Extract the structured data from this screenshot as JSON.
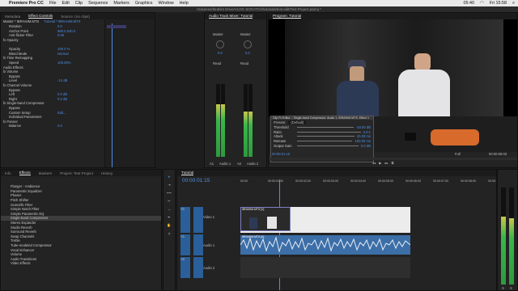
{
  "menubar": {
    "apple": "",
    "app": "Premiere Pro CC",
    "items": [
      "File",
      "Edit",
      "Clip",
      "Sequence",
      "Markers",
      "Graphics",
      "Window",
      "Help"
    ],
    "time": "05:40",
    "clock": "Fri 15:58"
  },
  "title": "/Volumes/Ibrahim Drive/VLOG SCRATCH/tutorials/test.edit/Test Project.prproj *",
  "effect_controls": {
    "tabs": [
      "Metadata",
      "Effect Controls",
      "Source: (no clips)"
    ],
    "clip_label": "Master * IBRAHIM.MTS",
    "seq_label": "Tutorial * IBRAHIM.MTS",
    "rows": [
      {
        "name": "Rotation",
        "value": "0.0"
      },
      {
        "name": "Anchor Point",
        "value": "960.0    540.0"
      },
      {
        "name": "Anti-flicker Filter",
        "value": "0.00"
      },
      {
        "name": "fx Opacity",
        "value": ""
      },
      {
        "name": "",
        "value": ""
      },
      {
        "name": "Opacity",
        "value": "100.0 %"
      },
      {
        "name": "Blend Mode",
        "value": "Normal"
      },
      {
        "name": "fx Time Remapping",
        "value": ""
      },
      {
        "name": "Speed",
        "value": "100.00%"
      },
      {
        "name": "Audio Effects",
        "value": ""
      },
      {
        "name": "fx Volume",
        "value": ""
      },
      {
        "name": "Bypass",
        "value": ""
      },
      {
        "name": "Level",
        "value": "-12 dB"
      },
      {
        "name": "fx Channel Volume",
        "value": ""
      },
      {
        "name": "Bypass",
        "value": ""
      },
      {
        "name": "Left",
        "value": "0.0 dB"
      },
      {
        "name": "Right",
        "value": "0.0 dB"
      },
      {
        "name": "fx Single-band Compressor",
        "value": ""
      },
      {
        "name": "Bypass",
        "value": ""
      },
      {
        "name": "Custom Setup",
        "value": "Edit..."
      },
      {
        "name": "Individual Parameters",
        "value": ""
      },
      {
        "name": "fx Panner",
        "value": ""
      },
      {
        "name": "Balance",
        "value": "0.0"
      }
    ],
    "playhead_time": "00:00:01:15"
  },
  "mixer": {
    "tab": "Audio Track Mixer: Tutorial",
    "ch1": "Master",
    "ch2": "Master",
    "read1": "Read",
    "read2": "Read",
    "db1": "0.0",
    "db2": "0.0",
    "label1": "A1",
    "label2": "Audio 1",
    "label3": "A2",
    "label4": "Audio 2"
  },
  "program": {
    "tab": "Program: Tutorial",
    "timecode": "00:00:01:15",
    "duration": "00:00:06:03",
    "fit": "Full",
    "overlay_title": "Clip Fx Editor – Single-band Compressor: Audio 1, IBRAHIM.MTS, Effect 1",
    "overlay_presets": "Presets:",
    "overlay_preset_value": "(Default)",
    "overlay_params": [
      {
        "name": "Threshold",
        "value": "-10.00 dB"
      },
      {
        "name": "Ratio",
        "value": "4.0:1"
      },
      {
        "name": "Attack",
        "value": "10.00 ms"
      },
      {
        "name": "Release",
        "value": "100.00 ms"
      },
      {
        "name": "Output Gain",
        "value": "0.0 dB"
      }
    ]
  },
  "project": {
    "tabs": [
      "Info",
      "Effects",
      "Markers",
      "Project: Test Project",
      "History"
    ],
    "items": [
      "Flanger - Ambience",
      "Parametric Equalizer",
      "Phaser",
      "Pitch Shifter",
      "Scientific Filter",
      "Simple Notch Filter",
      "Simple Parametric EQ",
      "Single-band Compressor",
      "Stereo Expander",
      "Studio Reverb",
      "Surround Reverb",
      "Swap Channels",
      "Treble",
      "Tube-modeled Compressor",
      "Vocal Enhancer",
      "Volume",
      "Audio Transitions",
      "Video Effects"
    ],
    "selected": 7
  },
  "timeline": {
    "tab": "Tutorial",
    "timecode": "00:00:01:15",
    "ruler": [
      "00:00",
      "00:00:01:00",
      "00:00:02:00",
      "00:00:03:00",
      "00:00:04:00",
      "00:00:05:00",
      "00:00:06:00",
      "00:00:07:00",
      "00:00:08:00",
      "00:00:09:00"
    ],
    "video_track": "Video 1",
    "audio_track": "Audio 1",
    "audio_track2": "Audio 2",
    "v1": "V1",
    "a1": "A1",
    "a2": "A2",
    "clip_name": "IBRAHIM.MTS [V]",
    "audio_clip": "IBRAHIM.MTS [A]"
  },
  "meters_right": {
    "labels": [
      "S",
      "S"
    ]
  },
  "colors": {
    "accent": "#4d8fe6",
    "meter_green": "#39b74a",
    "audio_clip": "#3c6ea7",
    "video_clip": "#7f7fc4"
  }
}
